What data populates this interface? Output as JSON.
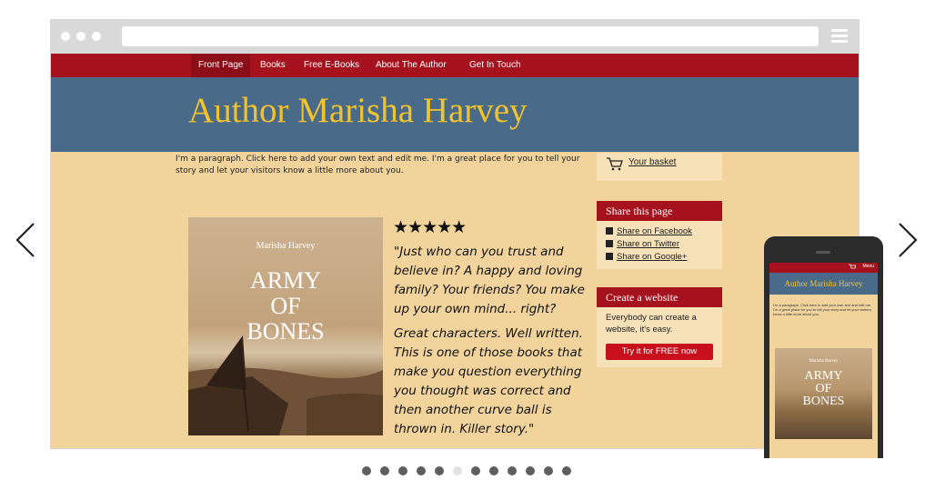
{
  "carousel": {
    "prev_icon": "chevron-left-icon",
    "next_icon": "chevron-right-icon",
    "slide_count": 12,
    "active_index": 5
  },
  "site": {
    "nav": [
      "Front Page",
      "Books",
      "Free E-Books",
      "About The Author",
      "Get In Touch"
    ],
    "title": "Author Marisha Harvey",
    "intro": "I'm a paragraph. Click here to add your own text and edit me. I'm a great place for you to tell your story and let your visitors know a little more about you.",
    "book": {
      "author": "Marisha Harvey",
      "title": "ARMY\nOF\nBONES"
    },
    "rating": "★★★★★",
    "review_1": "\"Just who can you trust and believe in? A happy and loving family? Your friends? You make up your own mind... right?",
    "review_2": "Great characters. Well written. This is one of those books that make you question everything you thought was correct and then another curve ball is thrown in. Killer story.\"",
    "basket": "Your basket",
    "share": {
      "heading": "Share this page",
      "items": [
        "Share on Facebook",
        "Share on Twitter",
        "Share on Google+"
      ]
    },
    "create": {
      "heading": "Create a website",
      "text": "Everybody can create a website, it's easy.",
      "button": "Try it for FREE now"
    }
  },
  "phone": {
    "menu": "Menu",
    "title": "Author Marisha Harvey",
    "intro": "I'm a paragraph. Click here to add your own text and edit me. I'm a great place for you to tell your story and let your visitors know a little more about you.",
    "book_author": "Marisha Harvey",
    "book_title": "ARMY\nOF\nBONES"
  },
  "colors": {
    "nav_red": "#a5121e",
    "hero_blue": "#4a6a89",
    "title_gold": "#f2c32b",
    "page_tan": "#f2d39b"
  }
}
